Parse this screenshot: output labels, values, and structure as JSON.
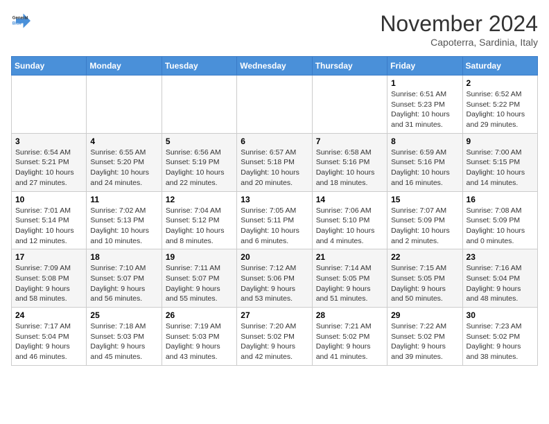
{
  "logo": {
    "line1": "General",
    "line2": "Blue"
  },
  "title": "November 2024",
  "location": "Capoterra, Sardinia, Italy",
  "days_of_week": [
    "Sunday",
    "Monday",
    "Tuesday",
    "Wednesday",
    "Thursday",
    "Friday",
    "Saturday"
  ],
  "weeks": [
    [
      {
        "day": "",
        "info": ""
      },
      {
        "day": "",
        "info": ""
      },
      {
        "day": "",
        "info": ""
      },
      {
        "day": "",
        "info": ""
      },
      {
        "day": "",
        "info": ""
      },
      {
        "day": "1",
        "info": "Sunrise: 6:51 AM\nSunset: 5:23 PM\nDaylight: 10 hours and 31 minutes."
      },
      {
        "day": "2",
        "info": "Sunrise: 6:52 AM\nSunset: 5:22 PM\nDaylight: 10 hours and 29 minutes."
      }
    ],
    [
      {
        "day": "3",
        "info": "Sunrise: 6:54 AM\nSunset: 5:21 PM\nDaylight: 10 hours and 27 minutes."
      },
      {
        "day": "4",
        "info": "Sunrise: 6:55 AM\nSunset: 5:20 PM\nDaylight: 10 hours and 24 minutes."
      },
      {
        "day": "5",
        "info": "Sunrise: 6:56 AM\nSunset: 5:19 PM\nDaylight: 10 hours and 22 minutes."
      },
      {
        "day": "6",
        "info": "Sunrise: 6:57 AM\nSunset: 5:18 PM\nDaylight: 10 hours and 20 minutes."
      },
      {
        "day": "7",
        "info": "Sunrise: 6:58 AM\nSunset: 5:16 PM\nDaylight: 10 hours and 18 minutes."
      },
      {
        "day": "8",
        "info": "Sunrise: 6:59 AM\nSunset: 5:16 PM\nDaylight: 10 hours and 16 minutes."
      },
      {
        "day": "9",
        "info": "Sunrise: 7:00 AM\nSunset: 5:15 PM\nDaylight: 10 hours and 14 minutes."
      }
    ],
    [
      {
        "day": "10",
        "info": "Sunrise: 7:01 AM\nSunset: 5:14 PM\nDaylight: 10 hours and 12 minutes."
      },
      {
        "day": "11",
        "info": "Sunrise: 7:02 AM\nSunset: 5:13 PM\nDaylight: 10 hours and 10 minutes."
      },
      {
        "day": "12",
        "info": "Sunrise: 7:04 AM\nSunset: 5:12 PM\nDaylight: 10 hours and 8 minutes."
      },
      {
        "day": "13",
        "info": "Sunrise: 7:05 AM\nSunset: 5:11 PM\nDaylight: 10 hours and 6 minutes."
      },
      {
        "day": "14",
        "info": "Sunrise: 7:06 AM\nSunset: 5:10 PM\nDaylight: 10 hours and 4 minutes."
      },
      {
        "day": "15",
        "info": "Sunrise: 7:07 AM\nSunset: 5:09 PM\nDaylight: 10 hours and 2 minutes."
      },
      {
        "day": "16",
        "info": "Sunrise: 7:08 AM\nSunset: 5:09 PM\nDaylight: 10 hours and 0 minutes."
      }
    ],
    [
      {
        "day": "17",
        "info": "Sunrise: 7:09 AM\nSunset: 5:08 PM\nDaylight: 9 hours and 58 minutes."
      },
      {
        "day": "18",
        "info": "Sunrise: 7:10 AM\nSunset: 5:07 PM\nDaylight: 9 hours and 56 minutes."
      },
      {
        "day": "19",
        "info": "Sunrise: 7:11 AM\nSunset: 5:07 PM\nDaylight: 9 hours and 55 minutes."
      },
      {
        "day": "20",
        "info": "Sunrise: 7:12 AM\nSunset: 5:06 PM\nDaylight: 9 hours and 53 minutes."
      },
      {
        "day": "21",
        "info": "Sunrise: 7:14 AM\nSunset: 5:05 PM\nDaylight: 9 hours and 51 minutes."
      },
      {
        "day": "22",
        "info": "Sunrise: 7:15 AM\nSunset: 5:05 PM\nDaylight: 9 hours and 50 minutes."
      },
      {
        "day": "23",
        "info": "Sunrise: 7:16 AM\nSunset: 5:04 PM\nDaylight: 9 hours and 48 minutes."
      }
    ],
    [
      {
        "day": "24",
        "info": "Sunrise: 7:17 AM\nSunset: 5:04 PM\nDaylight: 9 hours and 46 minutes."
      },
      {
        "day": "25",
        "info": "Sunrise: 7:18 AM\nSunset: 5:03 PM\nDaylight: 9 hours and 45 minutes."
      },
      {
        "day": "26",
        "info": "Sunrise: 7:19 AM\nSunset: 5:03 PM\nDaylight: 9 hours and 43 minutes."
      },
      {
        "day": "27",
        "info": "Sunrise: 7:20 AM\nSunset: 5:02 PM\nDaylight: 9 hours and 42 minutes."
      },
      {
        "day": "28",
        "info": "Sunrise: 7:21 AM\nSunset: 5:02 PM\nDaylight: 9 hours and 41 minutes."
      },
      {
        "day": "29",
        "info": "Sunrise: 7:22 AM\nSunset: 5:02 PM\nDaylight: 9 hours and 39 minutes."
      },
      {
        "day": "30",
        "info": "Sunrise: 7:23 AM\nSunset: 5:02 PM\nDaylight: 9 hours and 38 minutes."
      }
    ]
  ]
}
